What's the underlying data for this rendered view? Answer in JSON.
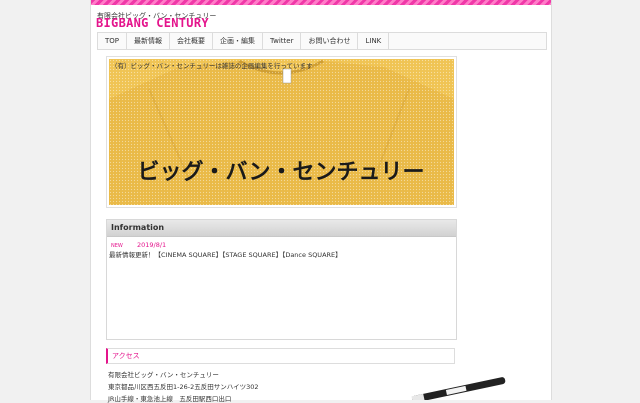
{
  "header": {
    "company_name": "有限会社ビッグ・バン・センチュリー",
    "logo_text": "BIGBANG CENTURY",
    "accent_color": "#e4148c"
  },
  "nav": {
    "items": [
      {
        "label": "TOP"
      },
      {
        "label": "最新情報"
      },
      {
        "label": "会社概要"
      },
      {
        "label": "企画・編集"
      },
      {
        "label": "Twitter"
      },
      {
        "label": "お問い合わせ"
      },
      {
        "label": "LINK"
      }
    ]
  },
  "hero": {
    "caption": "（有）ビッグ・バン・センチュリーは雑誌の企画編集を行っています",
    "shirt_text": "ビッグ・バン・センチュリー",
    "shirt_color": "#f0c454"
  },
  "information": {
    "title": "Information",
    "news": [
      {
        "badge": "NEW",
        "date": "2019/8/1",
        "text": "最新情報更新！【CINEMA SQUARE】【STAGE SQUARE】【Dance SQUARE】"
      }
    ]
  },
  "access": {
    "title": "アクセス",
    "lines": [
      "有限会社ビッグ・バン・センチュリー",
      "東京都品川区西五反田1-26-2五反田サンハイツ302",
      "JR山手線・東急池上線　五反田駅西口出口"
    ]
  }
}
